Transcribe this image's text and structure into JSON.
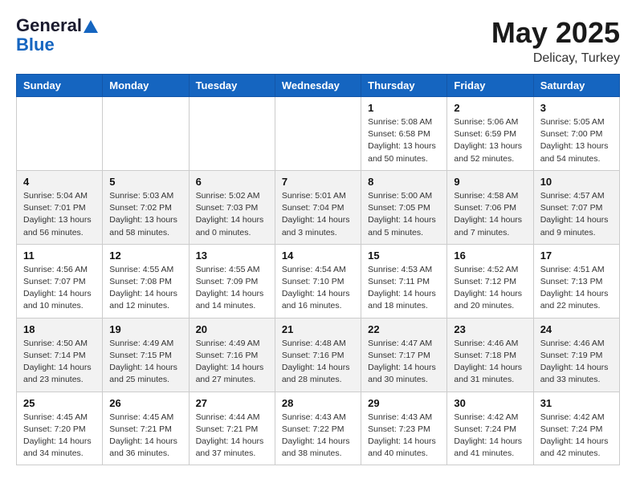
{
  "header": {
    "logo_line1": "General",
    "logo_line2": "Blue",
    "month_title": "May 2025",
    "subtitle": "Delicay, Turkey"
  },
  "days_of_week": [
    "Sunday",
    "Monday",
    "Tuesday",
    "Wednesday",
    "Thursday",
    "Friday",
    "Saturday"
  ],
  "weeks": [
    [
      {
        "day": "",
        "content": ""
      },
      {
        "day": "",
        "content": ""
      },
      {
        "day": "",
        "content": ""
      },
      {
        "day": "",
        "content": ""
      },
      {
        "day": "1",
        "content": "Sunrise: 5:08 AM\nSunset: 6:58 PM\nDaylight: 13 hours\nand 50 minutes."
      },
      {
        "day": "2",
        "content": "Sunrise: 5:06 AM\nSunset: 6:59 PM\nDaylight: 13 hours\nand 52 minutes."
      },
      {
        "day": "3",
        "content": "Sunrise: 5:05 AM\nSunset: 7:00 PM\nDaylight: 13 hours\nand 54 minutes."
      }
    ],
    [
      {
        "day": "4",
        "content": "Sunrise: 5:04 AM\nSunset: 7:01 PM\nDaylight: 13 hours\nand 56 minutes."
      },
      {
        "day": "5",
        "content": "Sunrise: 5:03 AM\nSunset: 7:02 PM\nDaylight: 13 hours\nand 58 minutes."
      },
      {
        "day": "6",
        "content": "Sunrise: 5:02 AM\nSunset: 7:03 PM\nDaylight: 14 hours\nand 0 minutes."
      },
      {
        "day": "7",
        "content": "Sunrise: 5:01 AM\nSunset: 7:04 PM\nDaylight: 14 hours\nand 3 minutes."
      },
      {
        "day": "8",
        "content": "Sunrise: 5:00 AM\nSunset: 7:05 PM\nDaylight: 14 hours\nand 5 minutes."
      },
      {
        "day": "9",
        "content": "Sunrise: 4:58 AM\nSunset: 7:06 PM\nDaylight: 14 hours\nand 7 minutes."
      },
      {
        "day": "10",
        "content": "Sunrise: 4:57 AM\nSunset: 7:07 PM\nDaylight: 14 hours\nand 9 minutes."
      }
    ],
    [
      {
        "day": "11",
        "content": "Sunrise: 4:56 AM\nSunset: 7:07 PM\nDaylight: 14 hours\nand 10 minutes."
      },
      {
        "day": "12",
        "content": "Sunrise: 4:55 AM\nSunset: 7:08 PM\nDaylight: 14 hours\nand 12 minutes."
      },
      {
        "day": "13",
        "content": "Sunrise: 4:55 AM\nSunset: 7:09 PM\nDaylight: 14 hours\nand 14 minutes."
      },
      {
        "day": "14",
        "content": "Sunrise: 4:54 AM\nSunset: 7:10 PM\nDaylight: 14 hours\nand 16 minutes."
      },
      {
        "day": "15",
        "content": "Sunrise: 4:53 AM\nSunset: 7:11 PM\nDaylight: 14 hours\nand 18 minutes."
      },
      {
        "day": "16",
        "content": "Sunrise: 4:52 AM\nSunset: 7:12 PM\nDaylight: 14 hours\nand 20 minutes."
      },
      {
        "day": "17",
        "content": "Sunrise: 4:51 AM\nSunset: 7:13 PM\nDaylight: 14 hours\nand 22 minutes."
      }
    ],
    [
      {
        "day": "18",
        "content": "Sunrise: 4:50 AM\nSunset: 7:14 PM\nDaylight: 14 hours\nand 23 minutes."
      },
      {
        "day": "19",
        "content": "Sunrise: 4:49 AM\nSunset: 7:15 PM\nDaylight: 14 hours\nand 25 minutes."
      },
      {
        "day": "20",
        "content": "Sunrise: 4:49 AM\nSunset: 7:16 PM\nDaylight: 14 hours\nand 27 minutes."
      },
      {
        "day": "21",
        "content": "Sunrise: 4:48 AM\nSunset: 7:16 PM\nDaylight: 14 hours\nand 28 minutes."
      },
      {
        "day": "22",
        "content": "Sunrise: 4:47 AM\nSunset: 7:17 PM\nDaylight: 14 hours\nand 30 minutes."
      },
      {
        "day": "23",
        "content": "Sunrise: 4:46 AM\nSunset: 7:18 PM\nDaylight: 14 hours\nand 31 minutes."
      },
      {
        "day": "24",
        "content": "Sunrise: 4:46 AM\nSunset: 7:19 PM\nDaylight: 14 hours\nand 33 minutes."
      }
    ],
    [
      {
        "day": "25",
        "content": "Sunrise: 4:45 AM\nSunset: 7:20 PM\nDaylight: 14 hours\nand 34 minutes."
      },
      {
        "day": "26",
        "content": "Sunrise: 4:45 AM\nSunset: 7:21 PM\nDaylight: 14 hours\nand 36 minutes."
      },
      {
        "day": "27",
        "content": "Sunrise: 4:44 AM\nSunset: 7:21 PM\nDaylight: 14 hours\nand 37 minutes."
      },
      {
        "day": "28",
        "content": "Sunrise: 4:43 AM\nSunset: 7:22 PM\nDaylight: 14 hours\nand 38 minutes."
      },
      {
        "day": "29",
        "content": "Sunrise: 4:43 AM\nSunset: 7:23 PM\nDaylight: 14 hours\nand 40 minutes."
      },
      {
        "day": "30",
        "content": "Sunrise: 4:42 AM\nSunset: 7:24 PM\nDaylight: 14 hours\nand 41 minutes."
      },
      {
        "day": "31",
        "content": "Sunrise: 4:42 AM\nSunset: 7:24 PM\nDaylight: 14 hours\nand 42 minutes."
      }
    ]
  ]
}
